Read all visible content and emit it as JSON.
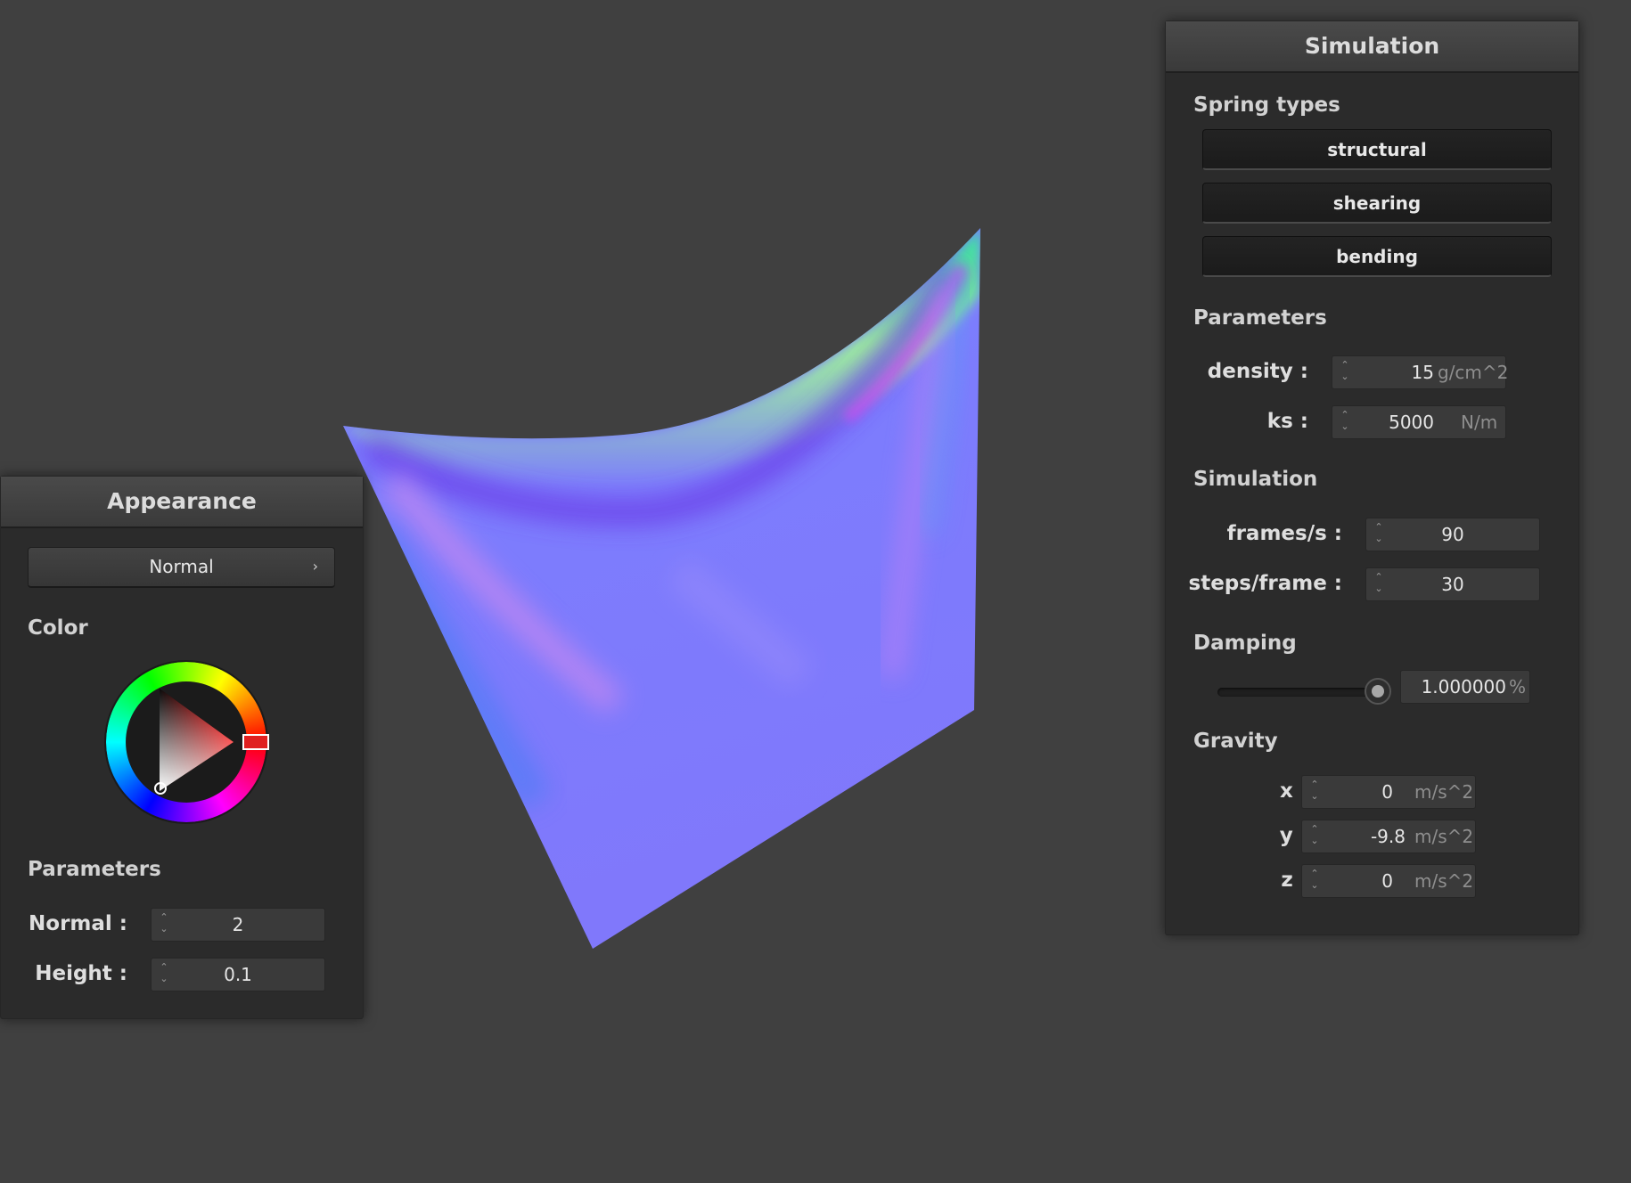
{
  "appearance": {
    "title": "Appearance",
    "shading_mode": "Normal",
    "color_label": "Color",
    "color_value": "#ff0000",
    "parameters_label": "Parameters",
    "normal_label": "Normal :",
    "normal_value": "2",
    "height_label": "Height :",
    "height_value": "0.1"
  },
  "simulation": {
    "title": "Simulation",
    "spring_types_label": "Spring types",
    "spring_buttons": [
      "structural",
      "shearing",
      "bending"
    ],
    "parameters_label": "Parameters",
    "density_label": "density :",
    "density_value": "15",
    "density_unit": "g/cm^2",
    "ks_label": "ks :",
    "ks_value": "5000",
    "ks_unit": "N/m",
    "simulation_label": "Simulation",
    "fps_label": "frames/s :",
    "fps_value": "90",
    "steps_label": "steps/frame :",
    "steps_value": "30",
    "damping_label": "Damping",
    "damping_slider_fraction": 0.98,
    "damping_value": "1.000000",
    "damping_unit": "%",
    "gravity_label": "Gravity",
    "gx_label": "x :",
    "gx_value": "0",
    "gy_label": "y :",
    "gy_value": "-9.8",
    "gz_label": "z :",
    "gz_value": "0",
    "gravity_unit": "m/s^2"
  }
}
